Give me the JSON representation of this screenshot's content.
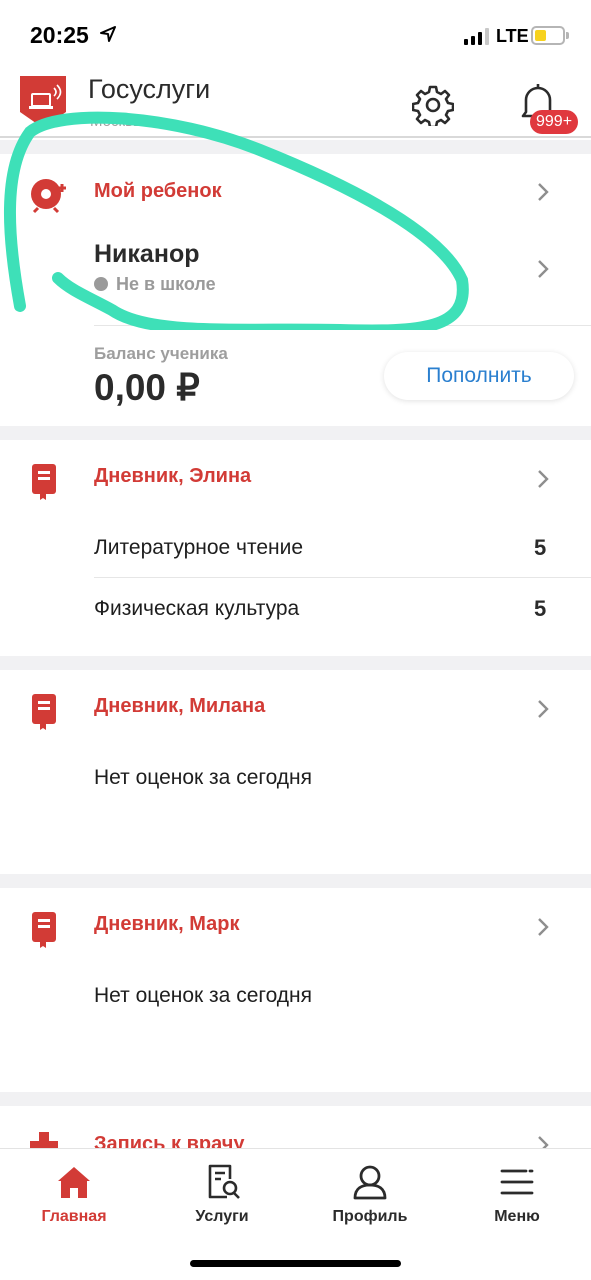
{
  "status_bar": {
    "time": "20:25",
    "network": "LTE"
  },
  "header": {
    "title": "Госуслуги",
    "subtitle": "Москвы",
    "notification_count": "999+"
  },
  "child_card": {
    "title": "Мой ребенок",
    "child_name": "Никанор",
    "status": "Не в школе",
    "balance_label": "Баланс ученика",
    "balance_value": "0,00 ₽",
    "topup_label": "Пополнить"
  },
  "diaries": [
    {
      "title": "Дневник, Элина",
      "rows": [
        {
          "subject": "Литературное чтение",
          "grade": "5"
        },
        {
          "subject": "Физическая культура",
          "grade": "5"
        }
      ]
    },
    {
      "title": "Дневник, Милана",
      "empty_text": "Нет оценок за сегодня"
    },
    {
      "title": "Дневник, Марк",
      "empty_text": "Нет оценок за сегодня"
    }
  ],
  "doctor_card": {
    "title": "Запись к врачу"
  },
  "tab_bar": {
    "tabs": [
      {
        "label": "Главная",
        "icon": "home-icon",
        "active": true
      },
      {
        "label": "Услуги",
        "icon": "services-icon",
        "active": false
      },
      {
        "label": "Профиль",
        "icon": "profile-icon",
        "active": false
      },
      {
        "label": "Меню",
        "icon": "menu-icon",
        "active": false
      }
    ]
  },
  "colors": {
    "accent": "#d23b36",
    "link": "#2a7fcf",
    "annotation": "#3ee0b8",
    "background_gap": "#f1f1f3"
  }
}
